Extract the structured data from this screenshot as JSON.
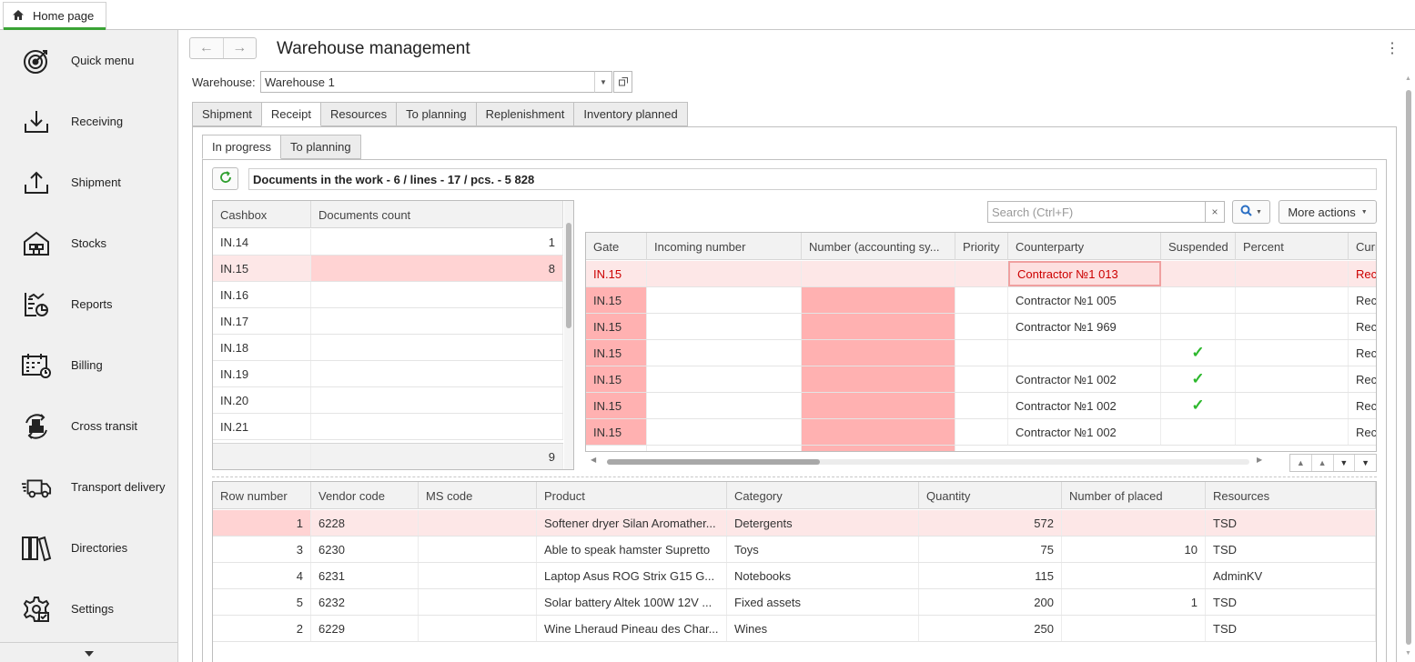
{
  "home_tab": {
    "label": "Home page"
  },
  "sidebar": {
    "items": [
      {
        "label": "Quick menu",
        "icon": "target-icon"
      },
      {
        "label": "Receiving",
        "icon": "receiving-icon"
      },
      {
        "label": "Shipment",
        "icon": "shipment-icon"
      },
      {
        "label": "Stocks",
        "icon": "warehouse-icon"
      },
      {
        "label": "Reports",
        "icon": "reports-icon"
      },
      {
        "label": "Billing",
        "icon": "calendar-icon"
      },
      {
        "label": "Cross transit",
        "icon": "cross-transit-icon"
      },
      {
        "label": "Transport delivery",
        "icon": "truck-icon"
      },
      {
        "label": "Directories",
        "icon": "books-icon"
      },
      {
        "label": "Settings",
        "icon": "gear-icon"
      }
    ]
  },
  "header": {
    "title": "Warehouse management"
  },
  "warehouse": {
    "label": "Warehouse:",
    "value": "Warehouse 1"
  },
  "tabs": [
    "Shipment",
    "Receipt",
    "Resources",
    "To planning",
    "Replenishment",
    "Inventory planned"
  ],
  "subtabs": [
    "In progress",
    "To planning"
  ],
  "docs_summary": "Documents in the work - 6 / lines - 17 / pcs. - 5 828",
  "cashbox_grid": {
    "headers": [
      "Cashbox",
      "Documents count"
    ],
    "rows": [
      {
        "cashbox": "IN.14",
        "count": "1"
      },
      {
        "cashbox": "IN.15",
        "count": "8"
      },
      {
        "cashbox": "IN.16",
        "count": ""
      },
      {
        "cashbox": "IN.17",
        "count": ""
      },
      {
        "cashbox": "IN.18",
        "count": ""
      },
      {
        "cashbox": "IN.19",
        "count": ""
      },
      {
        "cashbox": "IN.20",
        "count": ""
      },
      {
        "cashbox": "IN.21",
        "count": ""
      }
    ],
    "total": "9"
  },
  "search": {
    "placeholder": "Search (Ctrl+F)"
  },
  "more_actions": "More actions",
  "docs_grid": {
    "headers": [
      "Gate",
      "Incoming number",
      "Number (accounting sy...",
      "Priority",
      "Counterparty",
      "Suspended",
      "Percent",
      "Curr"
    ],
    "rows": [
      {
        "gate": "IN.15",
        "incoming": "",
        "number": "",
        "priority": "",
        "counterparty": "Contractor №1 013",
        "suspended": false,
        "percent": "",
        "curr": "Rec"
      },
      {
        "gate": "IN.15",
        "incoming": "",
        "number": "",
        "priority": "",
        "counterparty": "Contractor №1 005",
        "suspended": false,
        "percent": "",
        "curr": "Rec"
      },
      {
        "gate": "IN.15",
        "incoming": "",
        "number": "",
        "priority": "",
        "counterparty": "Contractor №1 969",
        "suspended": false,
        "percent": "",
        "curr": "Rec"
      },
      {
        "gate": "IN.15",
        "incoming": "",
        "number": "",
        "priority": "",
        "counterparty": "",
        "suspended": true,
        "percent": "",
        "curr": "Rec"
      },
      {
        "gate": "IN.15",
        "incoming": "",
        "number": "",
        "priority": "",
        "counterparty": "Contractor №1 002",
        "suspended": true,
        "percent": "",
        "curr": "Rec"
      },
      {
        "gate": "IN.15",
        "incoming": "",
        "number": "",
        "priority": "",
        "counterparty": "Contractor №1 002",
        "suspended": true,
        "percent": "",
        "curr": "Rec"
      },
      {
        "gate": "IN.15",
        "incoming": "",
        "number": "",
        "priority": "",
        "counterparty": "Contractor №1 002",
        "suspended": false,
        "percent": "",
        "curr": "Rec"
      }
    ]
  },
  "lines_grid": {
    "headers": [
      "Row number",
      "Vendor code",
      "MS code",
      "Product",
      "Category",
      "Quantity",
      "Number of placed",
      "Resources"
    ],
    "rows": [
      {
        "row": "1",
        "vendor": "6228",
        "ms": "",
        "product": "Softener dryer Silan Aromather...",
        "category": "Detergents",
        "qty": "572",
        "placed": "",
        "res": "TSD"
      },
      {
        "row": "3",
        "vendor": "6230",
        "ms": "",
        "product": "Able to speak hamster Supretto",
        "category": "Toys",
        "qty": "75",
        "placed": "10",
        "res": "TSD"
      },
      {
        "row": "4",
        "vendor": "6231",
        "ms": "",
        "product": "Laptop Asus ROG Strix G15 G...",
        "category": "Notebooks",
        "qty": "115",
        "placed": "",
        "res": "AdminKV"
      },
      {
        "row": "5",
        "vendor": "6232",
        "ms": "",
        "product": "Solar battery Altek 100W 12V ...",
        "category": "Fixed assets",
        "qty": "200",
        "placed": "1",
        "res": "TSD"
      },
      {
        "row": "2",
        "vendor": "6229",
        "ms": "",
        "product": "Wine Lheraud Pineau des Char...",
        "category": "Wines",
        "qty": "250",
        "placed": "",
        "res": "TSD"
      }
    ]
  }
}
